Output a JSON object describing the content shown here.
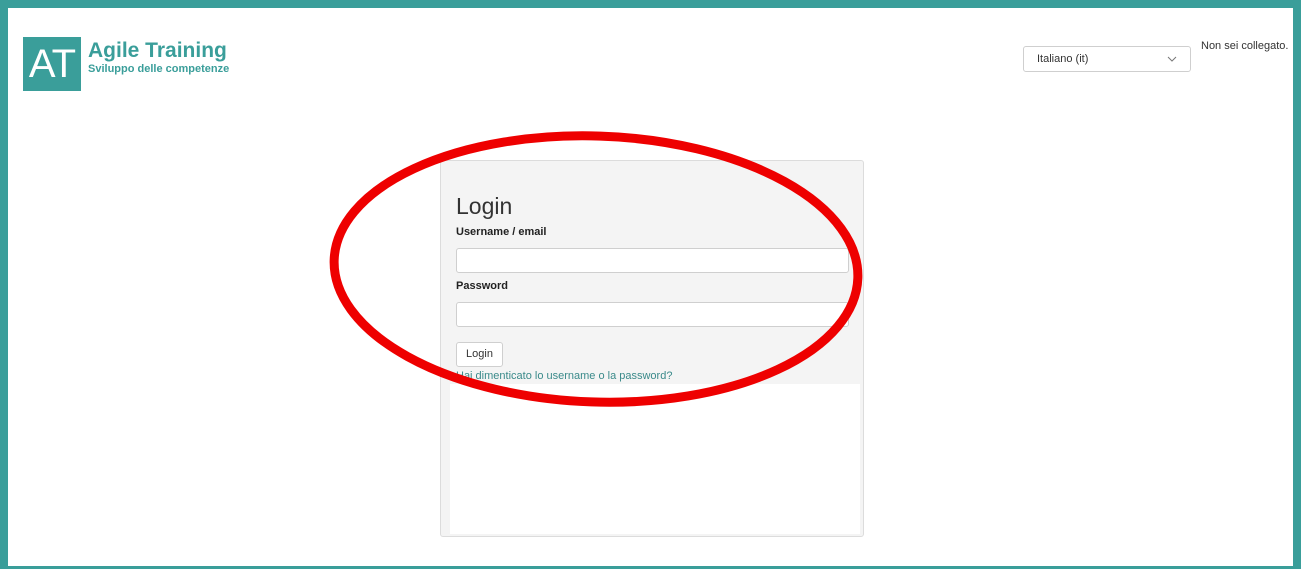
{
  "brand": {
    "logo_mark": "AT",
    "title": "Agile Training",
    "subtitle": "Sviluppo delle competenze",
    "accent_color": "#3a9e9a"
  },
  "header": {
    "language_select": {
      "value": "Italiano (it)",
      "icon": "chevron-down-icon"
    },
    "login_status": "Non sei collegato."
  },
  "login": {
    "title": "Login",
    "username_label": "Username / email",
    "username_value": "",
    "password_label": "Password",
    "password_value": "",
    "submit_label": "Login",
    "forgot_link": "Hai dimenticato lo username o la password?"
  },
  "annotation": {
    "shape": "ellipse",
    "color": "#ee0000"
  }
}
